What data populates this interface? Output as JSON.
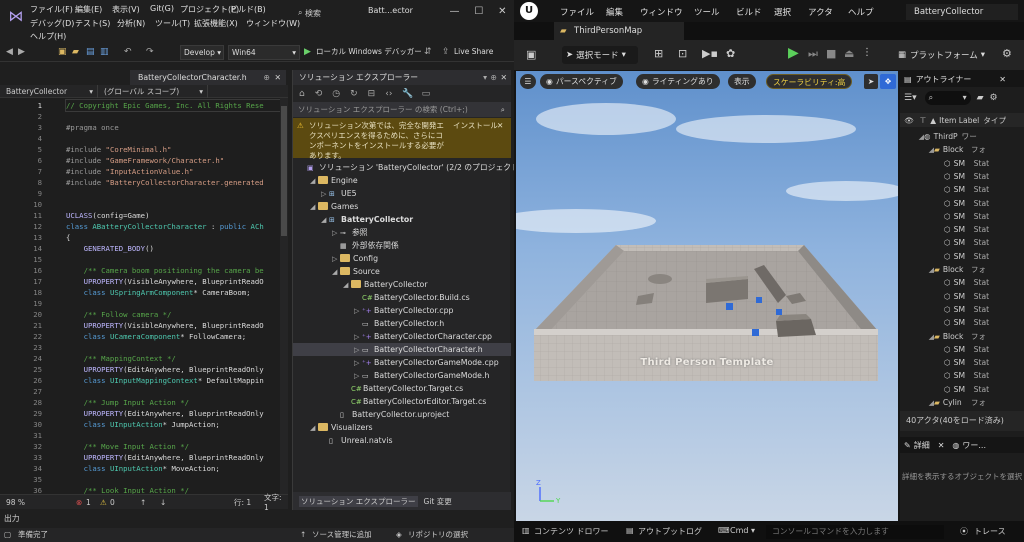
{
  "vs": {
    "menu": [
      "ファイル(F)",
      "編集(E)",
      "表示(V)",
      "Git(G)",
      "プロジェクト(P)",
      "ビルド(B)",
      "デバッグ(D)",
      "テスト(S)",
      "分析(N)",
      "ツール(T)",
      "拡張機能(X)",
      "ウィンドウ(W)",
      "ヘルプ(H)"
    ],
    "search_label": "検索",
    "window_title": "Batt...ector",
    "toolbar": {
      "config": "Develop",
      "platform": "Win64",
      "debugger": "ローカル Windows デバッガー",
      "live_share": "Live Share"
    },
    "editor": {
      "tab": "BatteryCollectorCharacter.h",
      "nav_project": "BatteryCollector",
      "nav_scope": "(グローバル スコープ)",
      "lines": [
        {
          "n": "1",
          "parts": [
            {
              "c": "cm",
              "t": "// Copyright Epic Games, Inc. All Rights Rese"
            }
          ]
        },
        {
          "n": "2",
          "parts": []
        },
        {
          "n": "3",
          "parts": [
            {
              "c": "pp",
              "t": "#pragma once"
            }
          ]
        },
        {
          "n": "4",
          "parts": []
        },
        {
          "n": "5",
          "parts": [
            {
              "c": "pp",
              "t": "#include "
            },
            {
              "c": "str",
              "t": "\"CoreMinimal.h\""
            }
          ]
        },
        {
          "n": "6",
          "parts": [
            {
              "c": "pp",
              "t": "#include "
            },
            {
              "c": "str",
              "t": "\"GameFramework/Character.h\""
            }
          ]
        },
        {
          "n": "7",
          "parts": [
            {
              "c": "pp",
              "t": "#include "
            },
            {
              "c": "str",
              "t": "\"InputActionValue.h\""
            }
          ]
        },
        {
          "n": "8",
          "parts": [
            {
              "c": "pp",
              "t": "#include "
            },
            {
              "c": "str",
              "t": "\"BatteryCollectorCharacter.generated"
            }
          ]
        },
        {
          "n": "9",
          "parts": []
        },
        {
          "n": "10",
          "parts": []
        },
        {
          "n": "11",
          "parts": [
            {
              "c": "mac",
              "t": "UCLASS"
            },
            {
              "c": "df",
              "t": "(config=Game)"
            }
          ]
        },
        {
          "n": "12",
          "parts": [
            {
              "c": "kw",
              "t": "class "
            },
            {
              "c": "ty",
              "t": "ABatteryCollectorCharacter"
            },
            {
              "c": "df",
              "t": " : "
            },
            {
              "c": "kw",
              "t": "public "
            },
            {
              "c": "ty",
              "t": "ACh"
            }
          ]
        },
        {
          "n": "13",
          "parts": [
            {
              "c": "df",
              "t": "{"
            }
          ]
        },
        {
          "n": "14",
          "parts": [
            {
              "c": "mac",
              "t": "    GENERATED_BODY"
            },
            {
              "c": "df",
              "t": "()"
            }
          ]
        },
        {
          "n": "15",
          "parts": []
        },
        {
          "n": "16",
          "parts": [
            {
              "c": "cm",
              "t": "    /** Camera boom positioning the camera be"
            }
          ]
        },
        {
          "n": "17",
          "parts": [
            {
              "c": "mac",
              "t": "    UPROPERTY"
            },
            {
              "c": "df",
              "t": "(VisibleAnywhere, BlueprintReadO"
            }
          ]
        },
        {
          "n": "18",
          "parts": [
            {
              "c": "kw",
              "t": "    class "
            },
            {
              "c": "ty",
              "t": "USpringArmComponent"
            },
            {
              "c": "df",
              "t": "* CameraBoom;"
            }
          ]
        },
        {
          "n": "19",
          "parts": []
        },
        {
          "n": "20",
          "parts": [
            {
              "c": "cm",
              "t": "    /** Follow camera */"
            }
          ]
        },
        {
          "n": "21",
          "parts": [
            {
              "c": "mac",
              "t": "    UPROPERTY"
            },
            {
              "c": "df",
              "t": "(VisibleAnywhere, BlueprintReadO"
            }
          ]
        },
        {
          "n": "22",
          "parts": [
            {
              "c": "kw",
              "t": "    class "
            },
            {
              "c": "ty",
              "t": "UCameraComponent"
            },
            {
              "c": "df",
              "t": "* FollowCamera;"
            }
          ]
        },
        {
          "n": "23",
          "parts": []
        },
        {
          "n": "24",
          "parts": [
            {
              "c": "cm",
              "t": "    /** MappingContext */"
            }
          ]
        },
        {
          "n": "25",
          "parts": [
            {
              "c": "mac",
              "t": "    UPROPERTY"
            },
            {
              "c": "df",
              "t": "(EditAnywhere, BlueprintReadOnly"
            }
          ]
        },
        {
          "n": "26",
          "parts": [
            {
              "c": "kw",
              "t": "    class "
            },
            {
              "c": "ty",
              "t": "UInputMappingContext"
            },
            {
              "c": "df",
              "t": "* DefaultMappin"
            }
          ]
        },
        {
          "n": "27",
          "parts": []
        },
        {
          "n": "28",
          "parts": [
            {
              "c": "cm",
              "t": "    /** Jump Input Action */"
            }
          ]
        },
        {
          "n": "29",
          "parts": [
            {
              "c": "mac",
              "t": "    UPROPERTY"
            },
            {
              "c": "df",
              "t": "(EditAnywhere, BlueprintReadOnly"
            }
          ]
        },
        {
          "n": "30",
          "parts": [
            {
              "c": "kw",
              "t": "    class "
            },
            {
              "c": "ty",
              "t": "UInputAction"
            },
            {
              "c": "df",
              "t": "* JumpAction;"
            }
          ]
        },
        {
          "n": "31",
          "parts": []
        },
        {
          "n": "32",
          "parts": [
            {
              "c": "cm",
              "t": "    /** Move Input Action */"
            }
          ]
        },
        {
          "n": "33",
          "parts": [
            {
              "c": "mac",
              "t": "    UPROPERTY"
            },
            {
              "c": "df",
              "t": "(EditAnywhere, BlueprintReadOnly"
            }
          ]
        },
        {
          "n": "34",
          "parts": [
            {
              "c": "kw",
              "t": "    class "
            },
            {
              "c": "ty",
              "t": "UInputAction"
            },
            {
              "c": "df",
              "t": "* MoveAction;"
            }
          ]
        },
        {
          "n": "35",
          "parts": []
        },
        {
          "n": "36",
          "parts": [
            {
              "c": "cm",
              "t": "    /** Look Input Action */"
            }
          ]
        }
      ],
      "status": {
        "zoom": "98 %",
        "errors": "1",
        "warnings": "0",
        "line": "行: 1",
        "col": "文字: 1"
      }
    },
    "solution": {
      "title": "ソリューション エクスプローラー",
      "search_placeholder": "ソリューション エクスプローラー の検索 (Ctrl+;)",
      "warning": "ソリューション次第では、完全な開発エクスペリエンスを得るために、さらにコンポーネントをインストールする必要があります。",
      "install": "インストール",
      "tree": [
        {
          "label": "ソリューション 'BatteryCollector' (2/2 のプロジェクト)",
          "depth": 0,
          "icon": "sln",
          "tw": ""
        },
        {
          "label": "Engine",
          "depth": 1,
          "icon": "fold",
          "tw": "◢"
        },
        {
          "label": "UE5",
          "depth": 2,
          "icon": "proj",
          "tw": "▷"
        },
        {
          "label": "Games",
          "depth": 1,
          "icon": "fold",
          "tw": "◢"
        },
        {
          "label": "BatteryCollector",
          "depth": 2,
          "icon": "proj",
          "tw": "◢",
          "bold": true
        },
        {
          "label": "参照",
          "depth": 3,
          "icon": "ref",
          "tw": "▷"
        },
        {
          "label": "外部依存関係",
          "depth": 3,
          "icon": "ext",
          "tw": ""
        },
        {
          "label": "Config",
          "depth": 3,
          "icon": "fold",
          "tw": "▷"
        },
        {
          "label": "Source",
          "depth": 3,
          "icon": "fold",
          "tw": "◢"
        },
        {
          "label": "BatteryCollector",
          "depth": 4,
          "icon": "fold",
          "tw": "◢"
        },
        {
          "label": "BatteryCollector.Build.cs",
          "depth": 5,
          "icon": "cs",
          "tw": ""
        },
        {
          "label": "BatteryCollector.cpp",
          "depth": 5,
          "icon": "cpp",
          "tw": "▷"
        },
        {
          "label": "BatteryCollector.h",
          "depth": 5,
          "icon": "h",
          "tw": ""
        },
        {
          "label": "BatteryCollectorCharacter.cpp",
          "depth": 5,
          "icon": "cpp",
          "tw": "▷"
        },
        {
          "label": "BatteryCollectorCharacter.h",
          "depth": 5,
          "icon": "h",
          "tw": "▷",
          "selected": true
        },
        {
          "label": "BatteryCollectorGameMode.cpp",
          "depth": 5,
          "icon": "cpp",
          "tw": "▷"
        },
        {
          "label": "BatteryCollectorGameMode.h",
          "depth": 5,
          "icon": "h",
          "tw": "▷"
        },
        {
          "label": "BatteryCollector.Target.cs",
          "depth": 4,
          "icon": "cs",
          "tw": ""
        },
        {
          "label": "BatteryCollectorEditor.Target.cs",
          "depth": 4,
          "icon": "cs",
          "tw": ""
        },
        {
          "label": "BatteryCollector.uproject",
          "depth": 3,
          "icon": "file",
          "tw": ""
        },
        {
          "label": "Visualizers",
          "depth": 1,
          "icon": "fold",
          "tw": "◢"
        },
        {
          "label": "Unreal.natvis",
          "depth": 2,
          "icon": "file",
          "tw": ""
        }
      ],
      "bottom_tabs": [
        "ソリューション エクスプローラー",
        "Git 変更"
      ]
    },
    "output_label": "出力",
    "status": {
      "ready": "準備完了",
      "source_control": "ソース管理に追加",
      "repo": "リポジトリの選択"
    }
  },
  "ue": {
    "menu": [
      "ファイル",
      "編集",
      "ウィンドウ",
      "ツール",
      "ビルド",
      "選択",
      "アクタ",
      "ヘルプ"
    ],
    "project": "BatteryCollector",
    "map_tab": "ThirdPersonMap",
    "toolbar": {
      "select_mode": "選択モード",
      "platform": "プラットフォーム"
    },
    "viewport": {
      "perspective": "パースペクティブ",
      "lighting": "ライティングあり",
      "show": "表示",
      "scalability": "スケーラビリティ:高",
      "floor_text": "Third Person Template"
    },
    "outliner": {
      "title": "アウトライナー",
      "col_label": "Item Label",
      "col_type": "タイプ",
      "rows": [
        {
          "label": "ThirdP",
          "type": "ワー",
          "depth": 1,
          "icon": "world"
        },
        {
          "label": "Block",
          "type": "フォ",
          "depth": 2,
          "icon": "fold"
        },
        {
          "label": "SM",
          "type": "Stat",
          "depth": 3,
          "icon": "mesh"
        },
        {
          "label": "SM",
          "type": "Stat",
          "depth": 3,
          "icon": "mesh"
        },
        {
          "label": "SM",
          "type": "Stat",
          "depth": 3,
          "icon": "mesh"
        },
        {
          "label": "SM",
          "type": "Stat",
          "depth": 3,
          "icon": "mesh"
        },
        {
          "label": "SM",
          "type": "Stat",
          "depth": 3,
          "icon": "mesh"
        },
        {
          "label": "SM",
          "type": "Stat",
          "depth": 3,
          "icon": "mesh"
        },
        {
          "label": "SM",
          "type": "Stat",
          "depth": 3,
          "icon": "mesh"
        },
        {
          "label": "SM",
          "type": "Stat",
          "depth": 3,
          "icon": "mesh"
        },
        {
          "label": "Block",
          "type": "フォ",
          "depth": 2,
          "icon": "fold"
        },
        {
          "label": "SM",
          "type": "Stat",
          "depth": 3,
          "icon": "mesh"
        },
        {
          "label": "SM",
          "type": "Stat",
          "depth": 3,
          "icon": "mesh"
        },
        {
          "label": "SM",
          "type": "Stat",
          "depth": 3,
          "icon": "mesh"
        },
        {
          "label": "SM",
          "type": "Stat",
          "depth": 3,
          "icon": "mesh"
        },
        {
          "label": "Block",
          "type": "フォ",
          "depth": 2,
          "icon": "fold"
        },
        {
          "label": "SM",
          "type": "Stat",
          "depth": 3,
          "icon": "mesh"
        },
        {
          "label": "SM",
          "type": "Stat",
          "depth": 3,
          "icon": "mesh"
        },
        {
          "label": "SM",
          "type": "Stat",
          "depth": 3,
          "icon": "mesh"
        },
        {
          "label": "SM",
          "type": "Stat",
          "depth": 3,
          "icon": "mesh"
        },
        {
          "label": "Cylin",
          "type": "フォ",
          "depth": 2,
          "icon": "fold"
        }
      ],
      "actor_count": "40アクタ(40をロード済み)"
    },
    "details": {
      "tab": "詳細",
      "tab2": "ワー...",
      "empty": "詳細を表示するオブジェクトを選択"
    },
    "bottom": {
      "content_drawer": "コンテンツ ドロワー",
      "output_log": "アウトプットログ",
      "cmd": "Cmd",
      "console_placeholder": "コンソールコマンドを入力します",
      "trace": "トレース"
    }
  }
}
